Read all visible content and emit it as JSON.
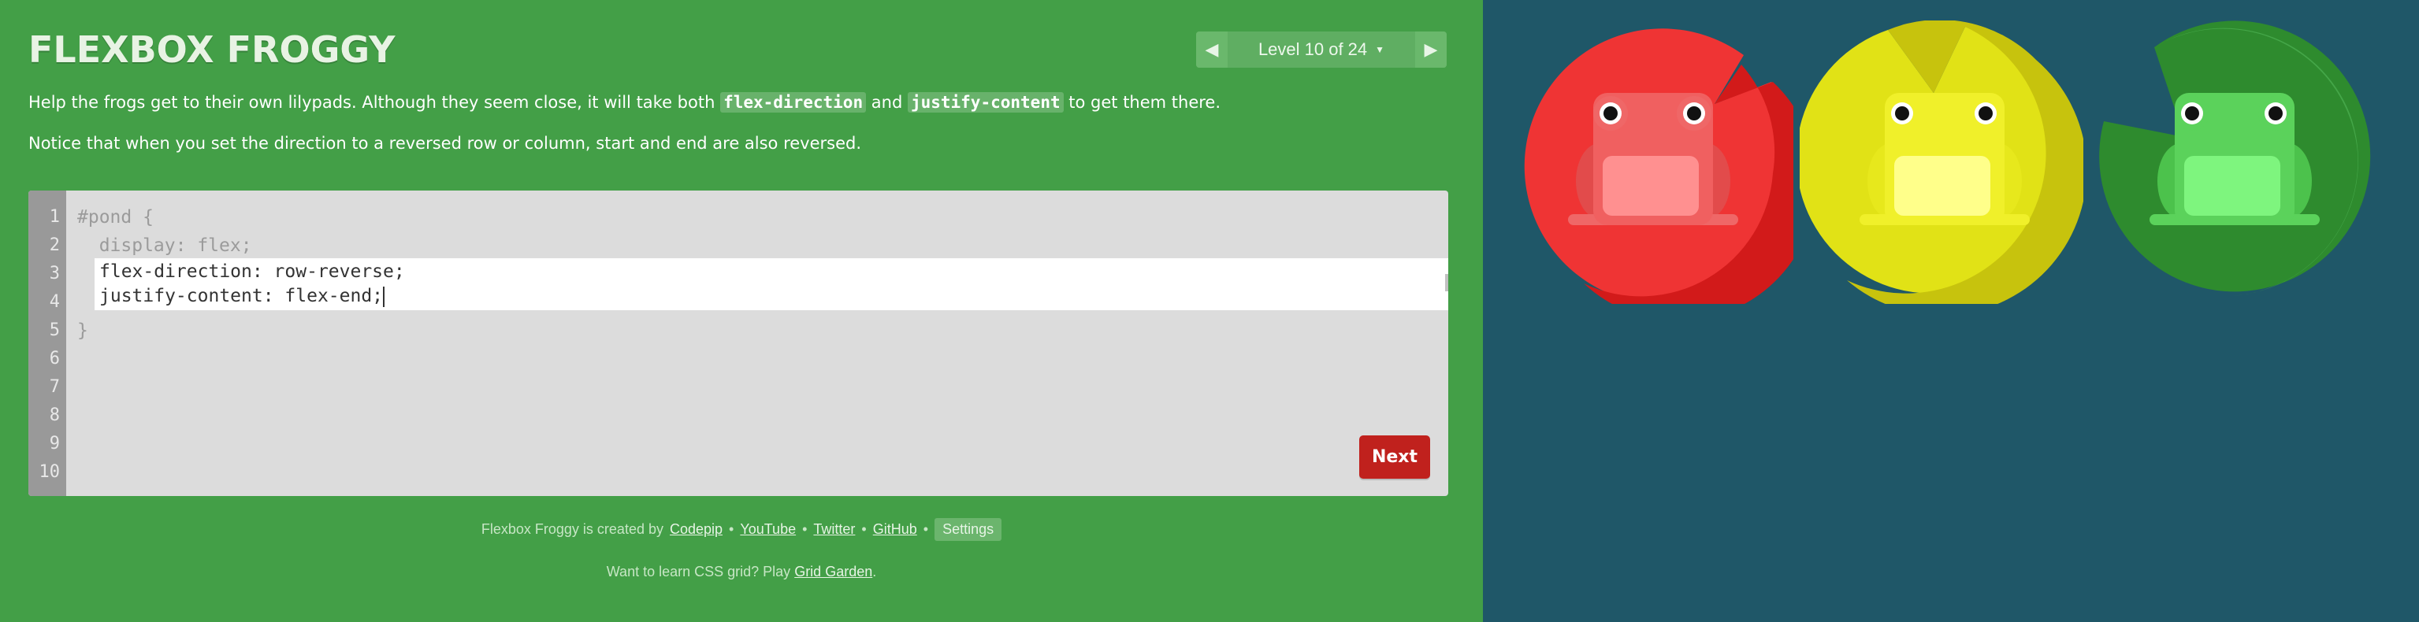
{
  "app": {
    "title": "FLEXBOX FROGGY"
  },
  "level_nav": {
    "prev_icon": "◀",
    "next_icon": "▶",
    "level_label": "Level 10 of 24",
    "dropdown_icon": "▼"
  },
  "instructions": {
    "p1_part1": "Help the frogs get to their own lilypads. Although they seem close, it will take both ",
    "kw1": "flex-direction",
    "p1_part2": " and ",
    "kw2": "justify-content",
    "p1_part3": " to get them there.",
    "p2": "Notice that when you set the direction to a reversed row or column, start and end are also reversed."
  },
  "editor": {
    "line_numbers": [
      "1",
      "2",
      "3",
      "4",
      "5",
      "6",
      "7",
      "8",
      "9",
      "10"
    ],
    "line1": "#pond {",
    "line2": "  display: flex;",
    "input_line1": "flex-direction: row-reverse;",
    "input_line2": "justify-content: flex-end;",
    "line5": "}",
    "scroll_up_icon": "▲",
    "scroll_down_icon": "▼"
  },
  "next_button": {
    "label": "Next"
  },
  "footer": {
    "credits_prefix": "Flexbox Froggy is created by",
    "link_codepip": "Codepip",
    "link_youtube": "YouTube",
    "link_twitter": "Twitter",
    "link_github": "GitHub",
    "separator": "•",
    "settings_label": "Settings",
    "grid_prefix": "Want to learn CSS grid? Play ",
    "grid_link": "Grid Garden",
    "grid_suffix": "."
  },
  "colors": {
    "sidebar_bg": "#439f47",
    "pond_bg": "#1f5768",
    "red": "#d41c1c",
    "yellow": "#d2d30d",
    "green": "#2e8b2e",
    "next_button": "#c0211d"
  },
  "pond": {
    "frogs": [
      {
        "color": "red",
        "icon": "frog-icon"
      },
      {
        "color": "yellow",
        "icon": "frog-icon"
      },
      {
        "color": "green",
        "icon": "frog-icon"
      }
    ],
    "lilypads": [
      {
        "color": "red"
      },
      {
        "color": "yellow"
      },
      {
        "color": "green"
      }
    ]
  }
}
